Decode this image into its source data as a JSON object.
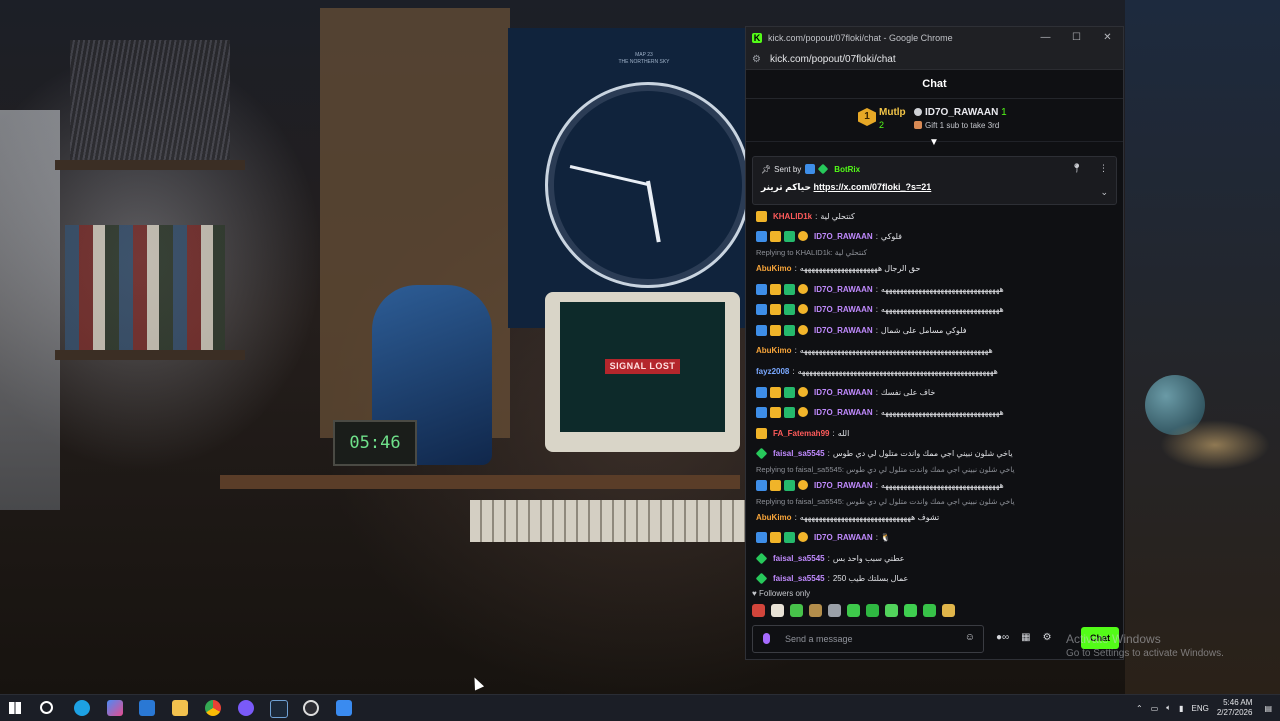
{
  "wallpaper": {
    "poster_title_1": "MAP 23",
    "poster_title_2": "THE NORTHERN SKY",
    "signal": "SIGNAL LOST",
    "timer": "05:46"
  },
  "window": {
    "title": "kick.com/popout/07floki/chat - Google Chrome",
    "url": "kick.com/popout/07floki/chat",
    "controls": {
      "minimize": "—",
      "maximize": "☐",
      "close": "✕"
    }
  },
  "chat": {
    "header": "Chat",
    "leaderboard": {
      "first_rank": "1",
      "first_name": "Mutlp",
      "first_count": "2",
      "second_name": "ID7O_RAWAAN",
      "second_count": "1",
      "gift_cta": "Gift 1 sub to take 3rd"
    },
    "pinned": {
      "sent_by_label": "Sent by",
      "sender": "BotRix",
      "text": "حياكم ترينر",
      "link": "https://x.com/07floki_?s=21"
    },
    "messages": [
      {
        "user": "KHALID1k",
        "color": "u-red",
        "badges": [
          "crown"
        ],
        "text": "كنتحلي لية"
      },
      {
        "user": "ID7O_RAWAAN",
        "color": "u-purple",
        "badges": [
          "mod",
          "crown",
          "sub",
          "num"
        ],
        "text": "فلوكي"
      },
      {
        "reply": "Replying to KHALID1k: كنتحلي لية"
      },
      {
        "user": "AbuKimo",
        "color": "u-orange",
        "badges": [],
        "text": "حق الرجال هههههههههههههههههههههه"
      },
      {
        "user": "ID7O_RAWAAN",
        "color": "u-purple",
        "badges": [
          "mod",
          "crown",
          "sub",
          "num"
        ],
        "text": "ههههههههههههههههههههههههههههههههه"
      },
      {
        "user": "ID7O_RAWAAN",
        "color": "u-purple",
        "badges": [
          "mod",
          "crown",
          "sub",
          "num"
        ],
        "text": "ههههههههههههههههههههههههههههههههه"
      },
      {
        "user": "ID7O_RAWAAN",
        "color": "u-purple",
        "badges": [
          "mod",
          "crown",
          "sub",
          "num"
        ],
        "text": "فلوكي مسامل على شمال"
      },
      {
        "user": "AbuKimo",
        "color": "u-orange",
        "badges": [],
        "text": "هههههههههههههههههههههههههههههههههههههههههههههههههههه"
      },
      {
        "user": "fayz2008",
        "color": "u-blue",
        "badges": [],
        "text": "هههههههههههههههههههههههههههههههههههههههههههههههههههههه"
      },
      {
        "user": "ID7O_RAWAAN",
        "color": "u-purple",
        "badges": [
          "mod",
          "crown",
          "sub",
          "num"
        ],
        "text": "خاف على نفسك"
      },
      {
        "user": "ID7O_RAWAAN",
        "color": "u-purple",
        "badges": [
          "mod",
          "crown",
          "sub",
          "num"
        ],
        "text": "ههههههههههههههههههههههههههههههههه"
      },
      {
        "user": "FA_Fatemah99",
        "color": "u-red",
        "badges": [
          "crown"
        ],
        "text": "الله"
      },
      {
        "user": "faisal_sa5545",
        "color": "u-purple",
        "badges": [
          "vip"
        ],
        "text": "ياخي شلون نبيني اجي ممك واندت متلول لي دي طوس"
      },
      {
        "reply": "Replying to faisal_sa5545: ياخي شلون نبيني اجي ممك واندت متلول لي دي طوس"
      },
      {
        "user": "ID7O_RAWAAN",
        "color": "u-purple",
        "badges": [
          "mod",
          "crown",
          "sub",
          "num"
        ],
        "text": "ههههههههههههههههههههههههههههههههه"
      },
      {
        "reply": "Replying to faisal_sa5545: ياخي شلون نبيني اجي ممك واندت متلول لي دي طوس"
      },
      {
        "user": "AbuKimo",
        "color": "u-orange",
        "badges": [],
        "text": "تشوف ههههههههههههههههههههههههههههههه"
      },
      {
        "user": "ID7O_RAWAAN",
        "color": "u-purple",
        "badges": [
          "mod",
          "crown",
          "sub",
          "num"
        ],
        "text": "🐧"
      },
      {
        "user": "faisal_sa5545",
        "color": "u-purple",
        "badges": [
          "vip"
        ],
        "text": "عطني سبب واحد بس"
      },
      {
        "user": "faisal_sa5545",
        "color": "u-purple",
        "badges": [
          "vip"
        ],
        "text": "250 عمال بسلتك طيب"
      }
    ],
    "followers_only": "Followers only",
    "input_placeholder": "Send a message",
    "send_label": "Chat",
    "colors": {
      "accent": "#53fc18",
      "purple": "#c18bff",
      "orange": "#f8a53a"
    }
  },
  "watermark": {
    "line1": "Activate Windows",
    "line2": "Go to Settings to activate Windows."
  },
  "taskbar": {
    "lang": "ENG",
    "time": "5:46 AM",
    "date": "2/27/2026"
  }
}
